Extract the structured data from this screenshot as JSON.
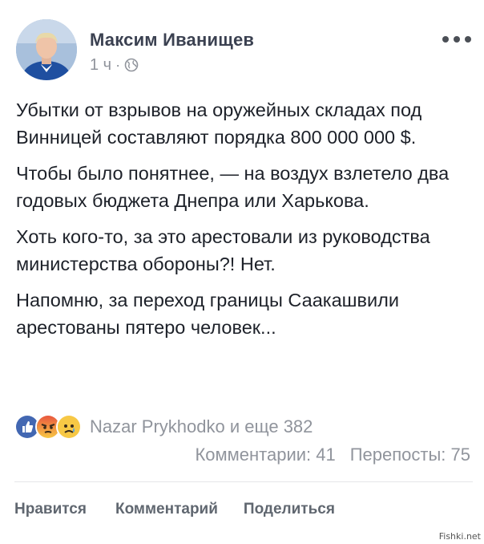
{
  "post": {
    "author": "Максим Иванищев",
    "timestamp": "1 ч",
    "separator": "·",
    "privacy_icon": "globe-icon",
    "more_icon": "more-options-icon",
    "paragraphs": [
      "Убытки от взрывов на оружейных складах под Винницей составляют порядка 800 000 000 $.",
      "Чтобы было понятнее, — на воздух взлетело два годовых бюджета Днепра или Харькова.",
      "Хоть кого-то, за это арестовали из руководства министерства обороны?! Нет.",
      "Напомню, за переход границы Саакашвили арестованы пятеро человек..."
    ]
  },
  "reactions": {
    "icons": [
      "like-reaction-icon",
      "angry-reaction-icon",
      "sad-reaction-icon"
    ],
    "summary": "Nazar Prykhodko и еще 382"
  },
  "counts": {
    "comments": "Комментарии: 41",
    "shares": "Перепосты: 75"
  },
  "actions": {
    "like": "Нравится",
    "comment": "Комментарий",
    "share": "Поделиться"
  },
  "watermark": "Fishki.net",
  "colors": {
    "name": "#3b4151",
    "body_text": "#1d2129",
    "meta": "#90949c",
    "like_blue": "#4267b2",
    "angry_red": "#e9573e",
    "sad_yellow": "#f7c845"
  }
}
